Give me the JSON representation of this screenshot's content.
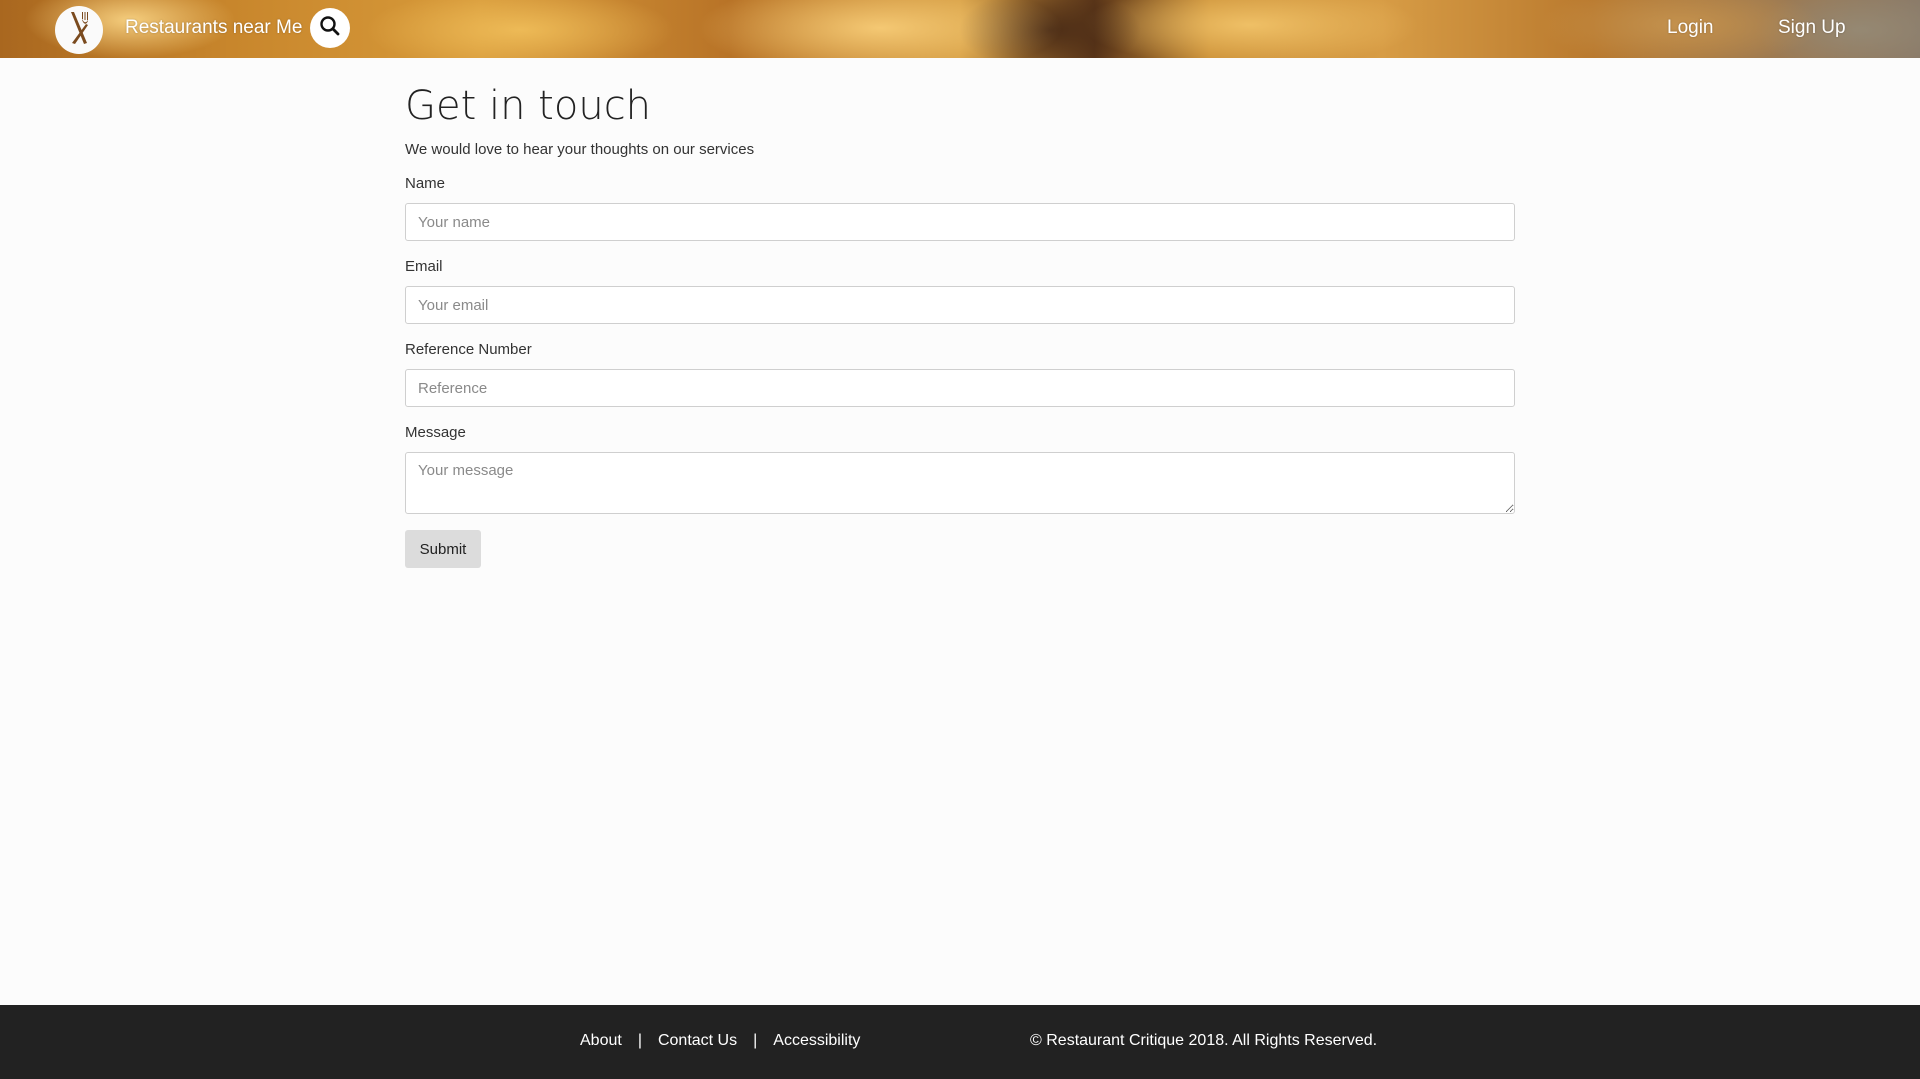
{
  "header": {
    "site_title": "Restaurants near Me",
    "nav": {
      "login": "Login",
      "signup": "Sign Up"
    },
    "icons": {
      "logo": "fork-knife-icon",
      "search": "search-icon"
    }
  },
  "form": {
    "title": "Get in touch",
    "subtitle": "We would love to hear your thoughts on our services",
    "fields": {
      "name": {
        "label": "Name",
        "placeholder": "Your name",
        "value": ""
      },
      "email": {
        "label": "Email",
        "placeholder": "Your email",
        "value": ""
      },
      "reference": {
        "label": "Reference Number",
        "placeholder": "Reference",
        "value": ""
      },
      "message": {
        "label": "Message",
        "placeholder": "Your message",
        "value": ""
      }
    },
    "submit_label": "Submit"
  },
  "footer": {
    "links": [
      "About",
      "Contact Us",
      "Accessibility"
    ],
    "separator": "|",
    "copyright": "© Restaurant Critique 2018. All Rights Reserved."
  },
  "colors": {
    "footer_bg": "#222222",
    "page_bg": "#fcfcfc",
    "button_bg": "#dcdcdc",
    "logo_utensil": "#7a4a1e"
  }
}
